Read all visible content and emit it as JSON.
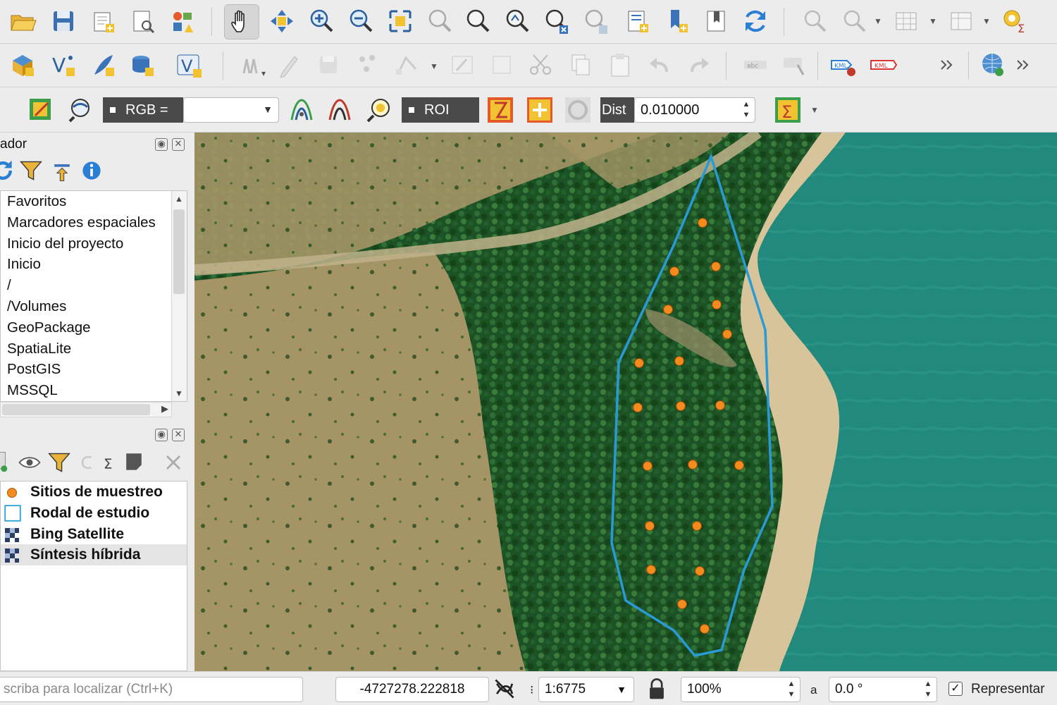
{
  "toolbar3": {
    "rgb_label": "RGB =",
    "rgb_combo_value": "",
    "roi_label": "ROI",
    "dist_label": "Dist",
    "dist_value": "0.010000"
  },
  "browser": {
    "title": "ador",
    "items": [
      {
        "label": "Favoritos"
      },
      {
        "label": "Marcadores espaciales"
      },
      {
        "label": "Inicio del proyecto"
      },
      {
        "label": "Inicio"
      },
      {
        "label": "/"
      },
      {
        "label": "/Volumes"
      },
      {
        "label": "GeoPackage"
      },
      {
        "label": "SpatiaLite"
      },
      {
        "label": "PostGIS"
      },
      {
        "label": "MSSQL"
      }
    ]
  },
  "layers": {
    "items": [
      {
        "label": "Sitios de muestreo",
        "symbol": "orange-point",
        "color": "#f58a1f"
      },
      {
        "label": "Rodal de estudio",
        "symbol": "blue-outline-polygon",
        "color": "#2aa0d8"
      },
      {
        "label": "Bing Satellite",
        "symbol": "raster-tile"
      },
      {
        "label": "Síntesis híbrida",
        "symbol": "raster-tile",
        "selected": true
      }
    ]
  },
  "map": {
    "sample_point_color": "#f58a1f",
    "polygon_color": "#2a9ad6"
  },
  "statusbar": {
    "locator_placeholder": "scriba para localizar (Ctrl+K)",
    "coordinate": "-4727278.222818",
    "scale_label": "1:6775",
    "magnifier": "100%",
    "rotation_label": "a",
    "rotation": "0.0 °",
    "render_label": "Representar",
    "render_checked": "✓"
  }
}
